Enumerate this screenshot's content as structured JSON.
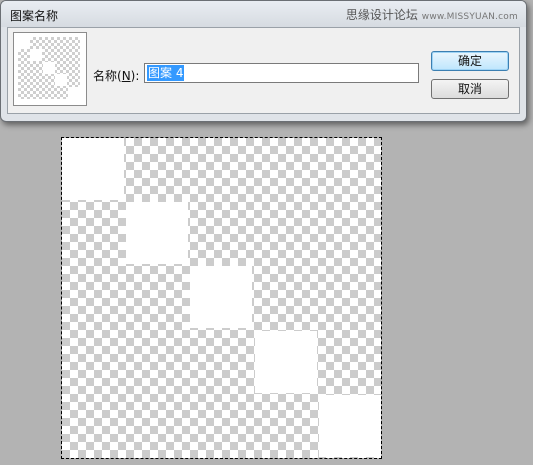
{
  "dialog": {
    "title": "图案名称",
    "watermark_main": "思缘设计论坛",
    "watermark_sub": "www.MISSYUAN.com",
    "name_label_prefix": "名称(",
    "name_label_key": "N",
    "name_label_suffix": "):",
    "name_value": "图案 4",
    "ok_label": "确定",
    "cancel_label": "取消"
  }
}
